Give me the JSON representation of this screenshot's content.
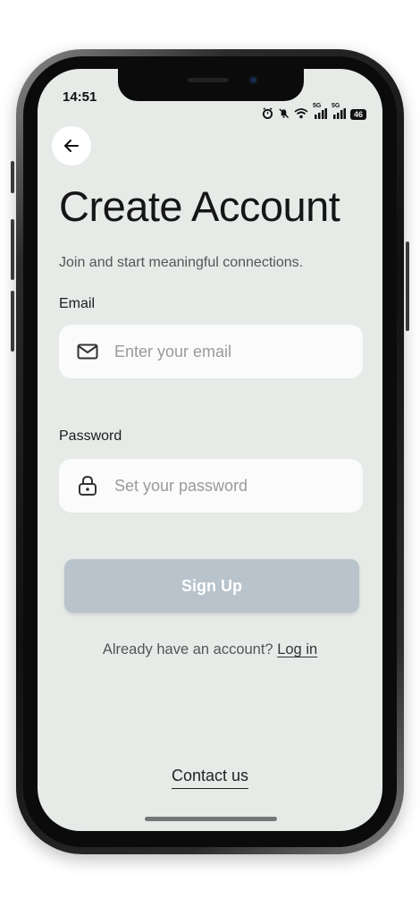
{
  "status_bar": {
    "time": "14:51",
    "icons": [
      "alarm-icon",
      "mute-icon",
      "wifi-icon",
      "signal-5g-1-icon",
      "signal-5g-2-icon"
    ],
    "network_1": "5G",
    "network_2": "5G",
    "battery": "46"
  },
  "header": {
    "back_icon": "arrow-left-icon",
    "title": "Create Account",
    "subtitle": "Join and start meaningful connections."
  },
  "form": {
    "email": {
      "label": "Email",
      "icon": "mail-icon",
      "placeholder": "Enter your email",
      "value": ""
    },
    "password": {
      "label": "Password",
      "icon": "lock-icon",
      "placeholder": "Set your password",
      "value": ""
    },
    "submit_label": "Sign Up"
  },
  "footer": {
    "already_text": "Already have an account?",
    "login_link": "Log in",
    "contact_link": "Contact us"
  },
  "colors": {
    "screen_bg": "#e7ebe8",
    "input_bg": "#fbfbfb",
    "button_bg": "#b8c3cb",
    "button_text": "#ffffff"
  }
}
